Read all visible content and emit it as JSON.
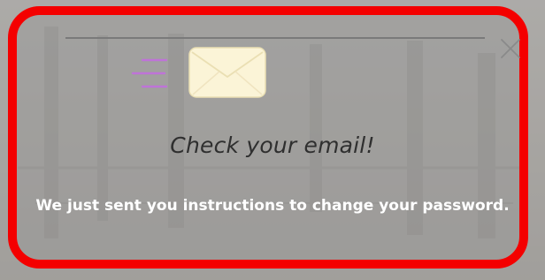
{
  "dialog": {
    "title": "Check your email!",
    "message": "We just sent you instructions to change your password."
  },
  "icons": {
    "mail": "envelope-icon",
    "speed_lines": "speed-lines-icon",
    "close": "close-icon"
  },
  "colors": {
    "border": "#f40000",
    "envelope_fill": "#fbf4d7",
    "envelope_stroke": "#eadfb3",
    "speed_lines": "#bf73d8",
    "title": "#2f2f2f",
    "message": "#ffffff",
    "close": "#8a8a8a"
  }
}
